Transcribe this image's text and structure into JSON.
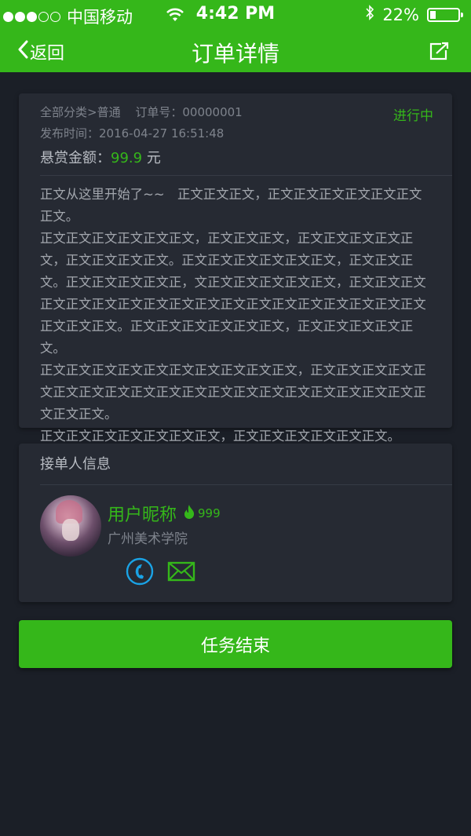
{
  "status_bar": {
    "carrier": "中国移动",
    "time": "4:42 PM",
    "battery_text": "22%",
    "battery_level": 0.22,
    "signal_dots_filled": 3,
    "signal_dots_total": 5
  },
  "nav": {
    "back_label": "返回",
    "title": "订单详情",
    "share_icon": "share-icon"
  },
  "order": {
    "category": "全部分类>普通",
    "order_no": "订单号：00000001",
    "publish_time": "发布时间：2016-04-27 16:51:48",
    "status": "进行中",
    "reward_label": "悬赏金额：",
    "reward_value": "99.9",
    "reward_unit": "元",
    "body": "正文从这里开始了~~　正文正文正文，正文正文正文正文正文正文正文。\n正文正文正文正文正文正文，正文正文正文，正文正文正文正文正文，正文正文正文正文。正文正文正文正文正文正文，正文正文正文。正文正文正文正文正，文正文正文正文正文正文，正文正文正文正文正文正文正文正文正文正文正文正文正文正文正文正文正文正文正文正文正文。正文正文正文正文正文正文，正文正文正文正文正文。\n正文正文正文正文正文正文正文正文正文正文，正文正文正文正文正文正文正文正文正文正文正文正文正文正文正文正文正文正文正文正文正文正文。\n正文正文正文正文正文正文正文，正文正文正文正文正文正文。"
  },
  "taker": {
    "section_title": "接单人信息",
    "nickname": "用户昵称",
    "score": "999",
    "school": "广州美术学院",
    "phone_icon": "phone-icon",
    "mail_icon": "mail-icon"
  },
  "actions": {
    "end_task_label": "任务结束"
  },
  "colors": {
    "accent": "#35b71a",
    "background": "#1b1f27",
    "card": "#262a33",
    "phone_icon": "#1aa3e6"
  }
}
